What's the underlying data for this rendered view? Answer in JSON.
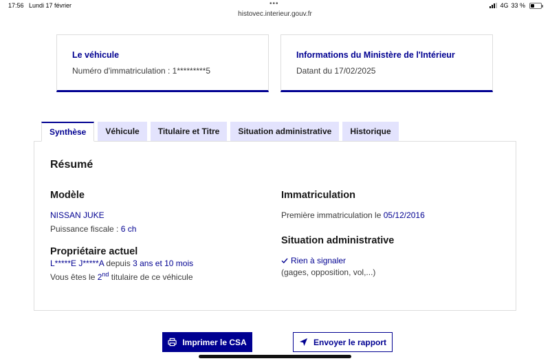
{
  "status_bar": {
    "time": "17:56",
    "date": "Lundi 17 février",
    "url": "histovec.interieur.gouv.fr",
    "network": "4G",
    "battery": "33 %",
    "battery_level": 0.33
  },
  "cards": {
    "vehicule": {
      "title": "Le véhicule",
      "text": "Numéro d'immatriculation : 1*********5"
    },
    "ministere": {
      "title": "Informations du Ministère de l'Intérieur",
      "text": "Datant du 17/02/2025"
    }
  },
  "tabs": [
    {
      "label": "Synthèse",
      "active": true
    },
    {
      "label": "Véhicule",
      "active": false
    },
    {
      "label": "Titulaire et Titre",
      "active": false
    },
    {
      "label": "Situation administrative",
      "active": false
    },
    {
      "label": "Historique",
      "active": false
    }
  ],
  "summary": {
    "title": "Résumé",
    "modele": {
      "heading": "Modèle",
      "name": "NISSAN JUKE",
      "puissance_label": "Puissance fiscale : ",
      "puissance_value": "6 ch"
    },
    "proprietaire": {
      "heading": "Propriétaire actuel",
      "name": "L*****E J*****A",
      "depuis_label": " depuis ",
      "depuis_value": "3 ans et 10 mois",
      "rank_prefix": "Vous êtes le ",
      "rank_number": "2",
      "rank_suffix": "nd",
      "rank_rest": " titulaire de ce véhicule"
    },
    "immatriculation": {
      "heading": "Immatriculation",
      "label": "Première immatriculation le ",
      "date": "05/12/2016"
    },
    "situation": {
      "heading": "Situation administrative",
      "status": "Rien à signaler",
      "details": "(gages, opposition, vol,...)"
    }
  },
  "buttons": {
    "print": "Imprimer le CSA",
    "send": "Envoyer le rapport"
  },
  "colors": {
    "accent": "#000091",
    "tab_bg": "#e3e3fd"
  },
  "icons": {
    "print": "printer-icon",
    "send": "send-icon",
    "check": "check-icon"
  }
}
